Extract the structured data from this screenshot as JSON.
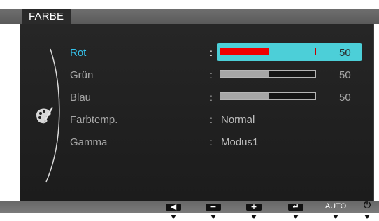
{
  "title": "FARBE",
  "menu": [
    {
      "label": "Rot",
      "type": "slider",
      "value": 50,
      "value_text": "50",
      "active": true
    },
    {
      "label": "Grün",
      "type": "slider",
      "value": 50,
      "value_text": "50",
      "active": false
    },
    {
      "label": "Blau",
      "type": "slider",
      "value": 50,
      "value_text": "50",
      "active": false
    },
    {
      "label": "Farbtemp.",
      "type": "text",
      "value_text": "Normal",
      "active": false
    },
    {
      "label": "Gamma",
      "type": "text",
      "value_text": "Modus1",
      "active": false
    }
  ],
  "separator": ":",
  "slider_max": 100,
  "buttons": [
    {
      "icon": "left-arrow-icon",
      "glyph": "◀"
    },
    {
      "icon": "minus-icon",
      "glyph": "−"
    },
    {
      "icon": "plus-icon",
      "glyph": "+"
    },
    {
      "icon": "enter-icon",
      "glyph": "↵"
    },
    {
      "icon": "auto-icon",
      "label": "AUTO"
    },
    {
      "icon": "power-icon",
      "glyph": "⏻"
    }
  ],
  "colors": {
    "accent": "#35c3ec",
    "highlight": "#4ccfd8",
    "active_fill": "#f00000"
  }
}
